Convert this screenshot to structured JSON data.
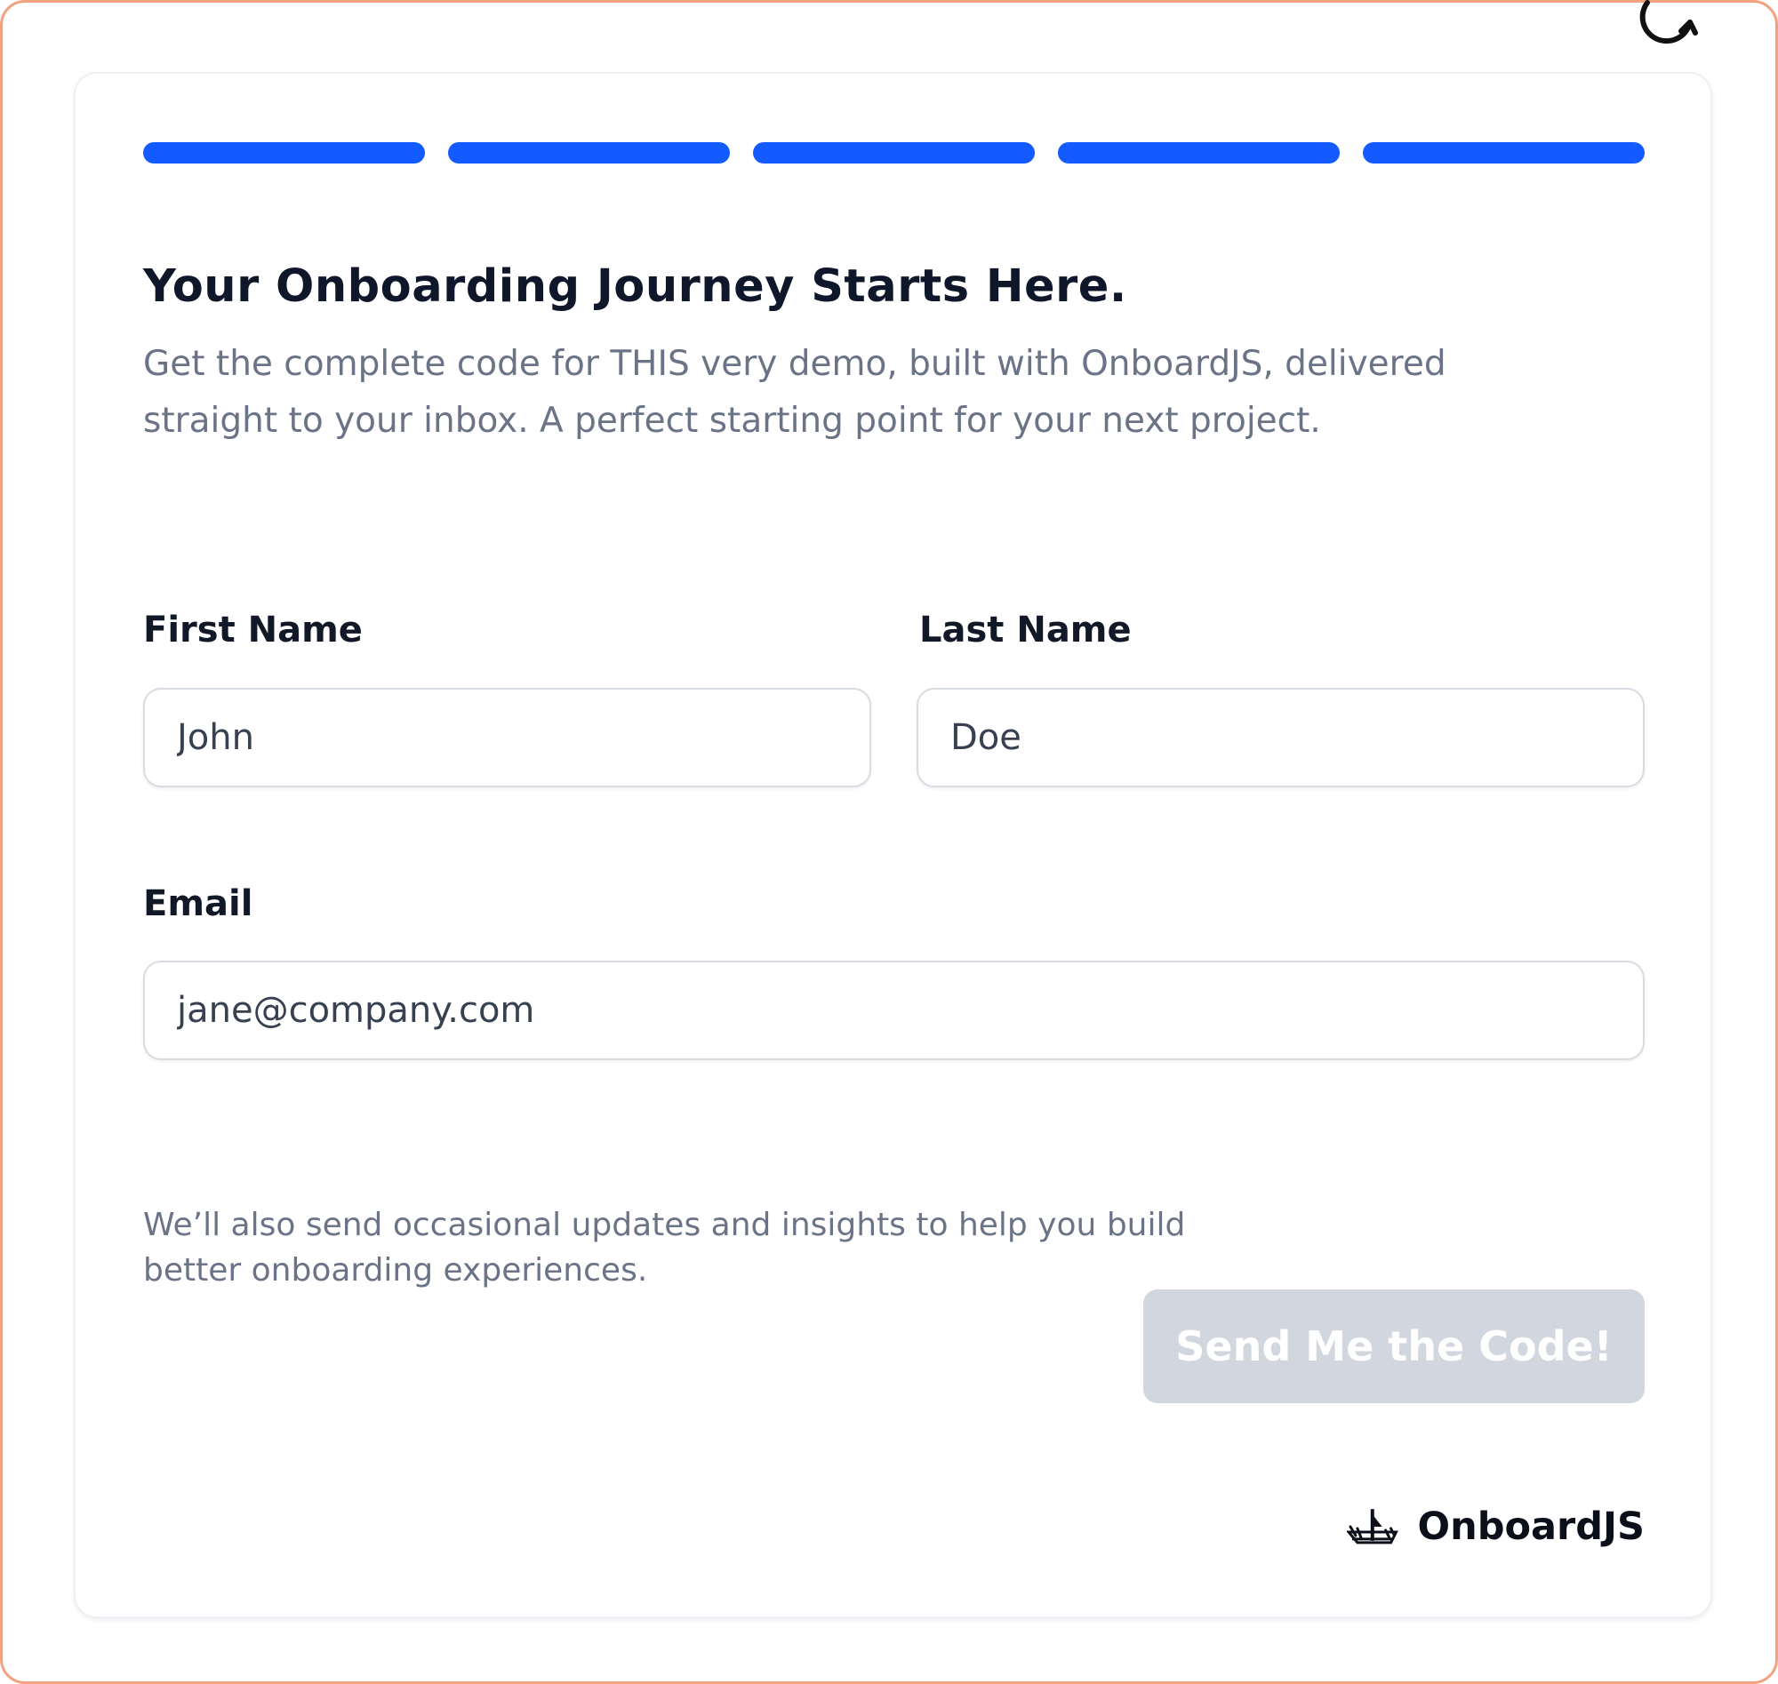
{
  "icons": {
    "refresh": "refresh-icon",
    "brand_logo": "onboardjs-logo-icon"
  },
  "colors": {
    "accent": "#135bff",
    "button_disabled": "#d2d6de",
    "text_primary": "#0f172a",
    "text_muted": "#6b7486",
    "frame_border": "#f3a27f"
  },
  "progress": {
    "total_steps": 5,
    "completed_steps": 5
  },
  "header": {
    "title": "Your Onboarding Journey Starts Here.",
    "subtitle": "Get the complete code for THIS very demo, built with OnboardJS, delivered straight to your inbox. A perfect starting point for your next project."
  },
  "form": {
    "first_name": {
      "label": "First Name",
      "placeholder": "John",
      "value": ""
    },
    "last_name": {
      "label": "Last Name",
      "placeholder": "Doe",
      "value": ""
    },
    "email": {
      "label": "Email",
      "placeholder": "jane@company.com",
      "value": ""
    },
    "note": "We’ll also send occasional updates and insights to help you build better onboarding experiences.",
    "submit_label": "Send Me the Code!"
  },
  "brand": {
    "name": "OnboardJS"
  }
}
